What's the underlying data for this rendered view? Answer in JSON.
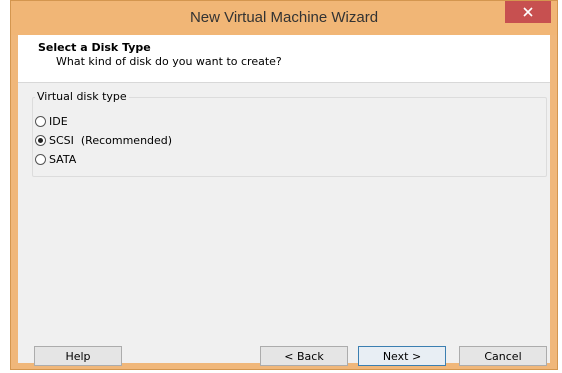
{
  "window": {
    "title": "New Virtual Machine Wizard",
    "close_icon": "close-icon"
  },
  "header": {
    "title": "Select a Disk Type",
    "subtitle": "What kind of disk do you want to create?"
  },
  "disk_type": {
    "group_label": "Virtual disk type",
    "options": [
      {
        "label": "IDE",
        "checked": false
      },
      {
        "label": "SCSI  (Recommended)",
        "checked": true
      },
      {
        "label": "SATA",
        "checked": false
      }
    ]
  },
  "buttons": {
    "help": "Help",
    "back": "< Back",
    "next": "Next >",
    "cancel": "Cancel"
  },
  "colors": {
    "titlebar": "#f1b676",
    "close_button": "#c75050"
  }
}
